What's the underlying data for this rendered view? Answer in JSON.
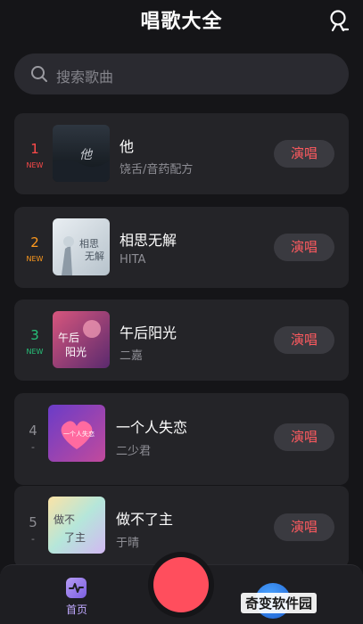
{
  "app": {
    "title": "唱歌大全"
  },
  "colors": {
    "accent": "#ff4e5d",
    "rank_1": "#ff4a4a",
    "rank_2": "#ff9a1e",
    "rank_3": "#27c27a",
    "rank_other": "#8c8c92"
  },
  "search": {
    "placeholder": "搜索歌曲",
    "icon": "search-icon"
  },
  "songs": [
    {
      "rank": "1",
      "badge": "NEW",
      "title": "他",
      "artist": "饶舌/音药配方",
      "action": "演唱"
    },
    {
      "rank": "2",
      "badge": "NEW",
      "title": "相思无解",
      "artist": "HITA",
      "action": "演唱"
    },
    {
      "rank": "3",
      "badge": "NEW",
      "title": "午后阳光",
      "artist": "二嘉",
      "action": "演唱"
    },
    {
      "rank": "4",
      "badge": "-",
      "title": "一个人失恋",
      "artist": "二少君",
      "action": "演唱"
    },
    {
      "rank": "5",
      "badge": "-",
      "title": "做不了主",
      "artist": "于晴",
      "action": "演唱"
    }
  ],
  "tabbar": {
    "home_label": "首页"
  },
  "watermark": {
    "text": "奇变软件园"
  }
}
